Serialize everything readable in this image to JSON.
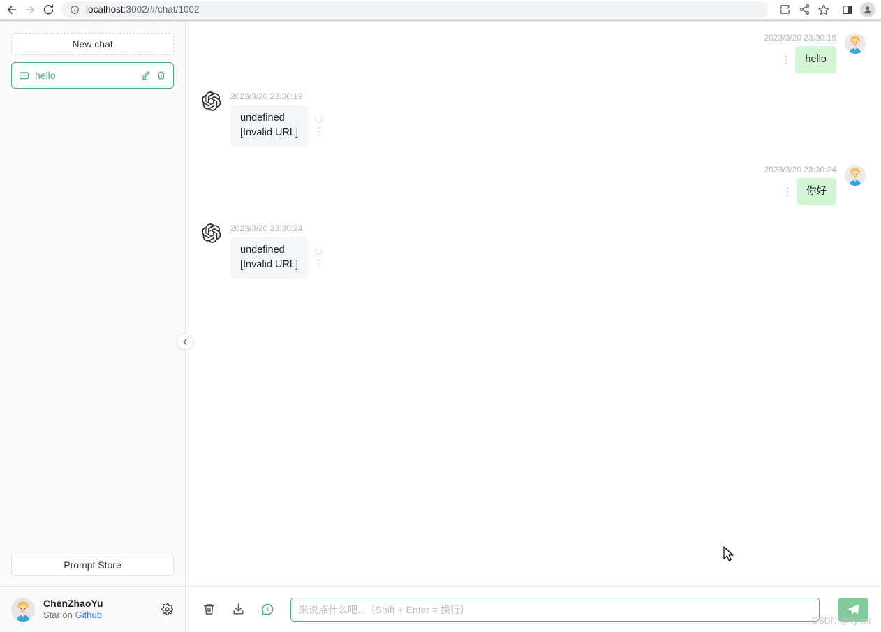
{
  "browser": {
    "back_icon": "back-arrow-icon",
    "forward_icon": "forward-arrow-icon",
    "reload_icon": "reload-icon",
    "site_info_icon": "info-circle-icon",
    "url_host": "localhost",
    "url_path": ":3002/#/chat/1002",
    "url_full": "localhost:3002/#/chat/1002",
    "actions": [
      {
        "name": "install-app-icon",
        "label": "Install app"
      },
      {
        "name": "share-icon",
        "label": "Share"
      },
      {
        "name": "bookmark-star-icon",
        "label": "Bookmark"
      },
      {
        "name": "side-panel-icon",
        "label": "Side panel"
      },
      {
        "name": "profile-avatar-icon",
        "label": "Profile"
      }
    ]
  },
  "sidebar": {
    "new_chat_label": "New chat",
    "chats": [
      {
        "title": "hello",
        "icon": "message-square-icon",
        "edit_icon": "pencil-icon",
        "delete_icon": "trash-icon",
        "active": true
      }
    ],
    "prompt_store_label": "Prompt Store",
    "collapse_icon": "chevron-left-icon",
    "footer": {
      "avatar": "user-avatar",
      "name": "ChenZhaoYu",
      "subtitle_prefix": "Star on ",
      "subtitle_link": "Github",
      "settings_icon": "gear-icon"
    }
  },
  "chat": {
    "messages": [
      {
        "role": "user",
        "timestamp": "2023/3/20 23:30:19",
        "text": "hello",
        "avatar": "user-avatar",
        "menu_icon": "more-vertical-icon"
      },
      {
        "role": "assistant",
        "timestamp": "2023/3/20 23:30:19",
        "text": "undefined\n[Invalid URL]",
        "avatar": "openai-logo-icon",
        "loading_icon": "spinner-icon",
        "menu_icon": "more-vertical-icon"
      },
      {
        "role": "user",
        "timestamp": "2023/3/20 23:30:24",
        "text": "你好",
        "avatar": "user-avatar",
        "menu_icon": "more-vertical-icon"
      },
      {
        "role": "assistant",
        "timestamp": "2023/3/20 23:30:24",
        "text": "undefined\n[Invalid URL]",
        "avatar": "openai-logo-icon",
        "loading_icon": "spinner-icon",
        "menu_icon": "more-vertical-icon"
      }
    ]
  },
  "composer": {
    "clear_icon": "trash-icon",
    "export_icon": "download-icon",
    "history_icon": "chat-history-icon",
    "input_value": "",
    "input_placeholder": "来说点什么吧...（Shift + Enter = 换行）",
    "send_icon": "send-plane-icon"
  },
  "watermark": "CSDN @fly-iot",
  "colors": {
    "accent_green": "#4cae72",
    "user_bubble": "#d2f6d3",
    "assistant_bubble": "#f4f6f8",
    "send_button": "#82c99b",
    "link_blue": "#3b82f6",
    "timestamp_gray": "#b4b4b4"
  }
}
